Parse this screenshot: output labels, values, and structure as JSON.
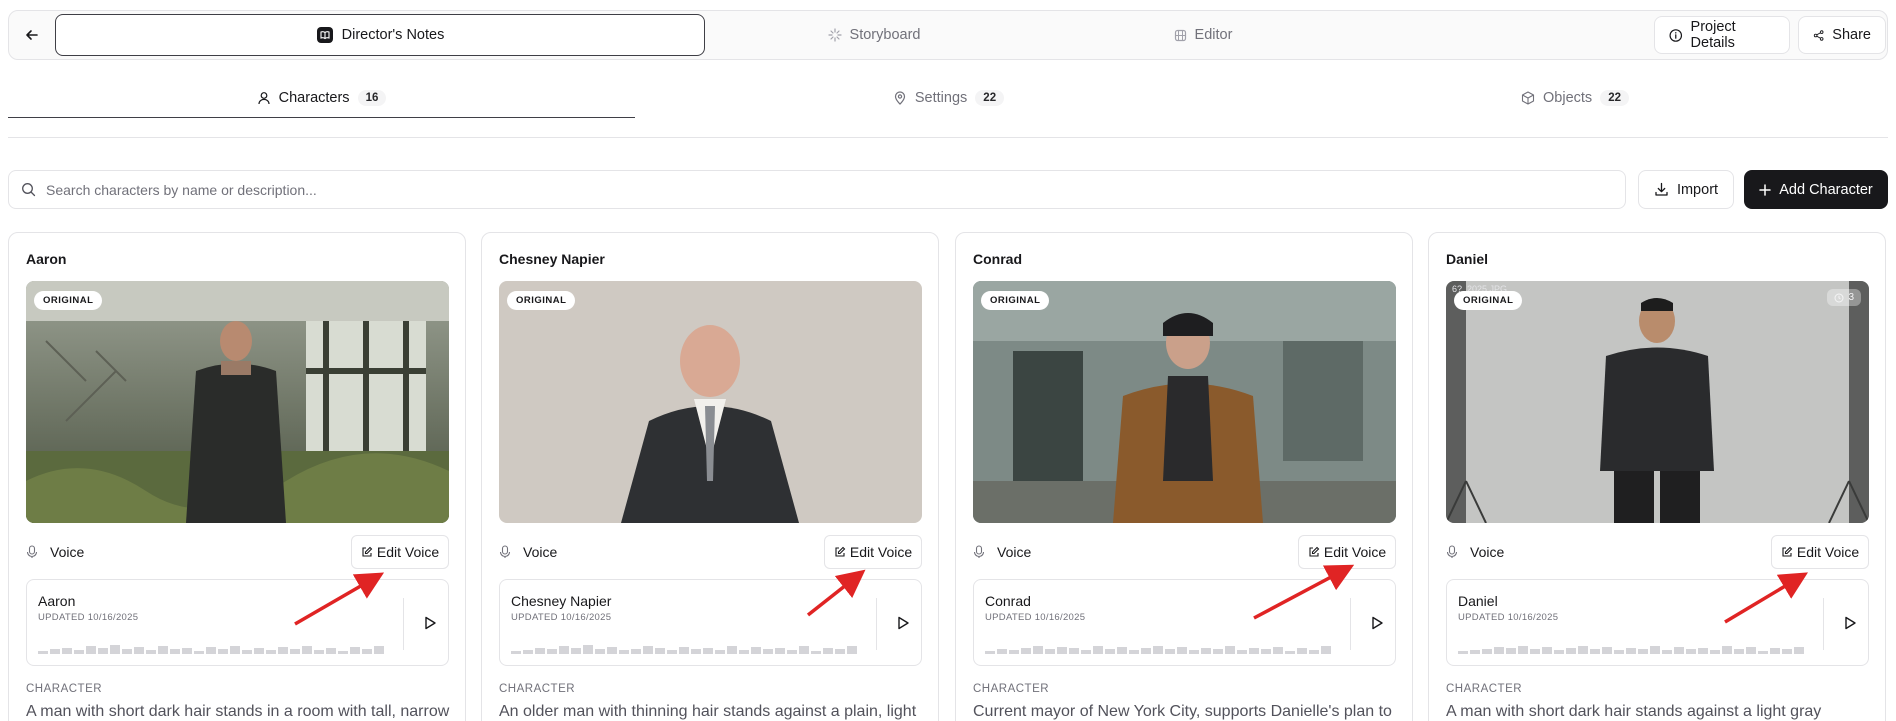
{
  "topbar": {
    "back_icon": "arrow-left-icon",
    "tabs": [
      {
        "label": "Director's Notes",
        "icon": "book-icon",
        "active": true
      },
      {
        "label": "Storyboard",
        "icon": "sparkle-icon",
        "active": false
      },
      {
        "label": "Editor",
        "icon": "film-icon",
        "active": false
      }
    ],
    "project_details_label": "Project Details",
    "share_label": "Share"
  },
  "subtabs": [
    {
      "label": "Characters",
      "count": "16",
      "icon": "user-icon",
      "active": true
    },
    {
      "label": "Settings",
      "count": "22",
      "icon": "map-pin-icon",
      "active": false
    },
    {
      "label": "Objects",
      "count": "22",
      "icon": "cube-icon",
      "active": false
    }
  ],
  "search": {
    "placeholder": "Search characters by name or description...",
    "value": ""
  },
  "import_label": "Import",
  "add_label": "Add Character",
  "cards": [
    {
      "name": "Aaron",
      "badge": "ORIGINAL",
      "voice_label": "Voice",
      "edit_voice_label": "Edit Voice",
      "player_name": "Aaron",
      "updated": "UPDATED 10/16/2025",
      "section_label": "CHARACTER",
      "description": "A man with short dark hair stands in a room with tall, narrow"
    },
    {
      "name": "Chesney Napier",
      "badge": "ORIGINAL",
      "voice_label": "Voice",
      "edit_voice_label": "Edit Voice",
      "player_name": "Chesney Napier",
      "updated": "UPDATED 10/16/2025",
      "section_label": "CHARACTER",
      "description": "An older man with thinning hair stands against a plain, light"
    },
    {
      "name": "Conrad",
      "badge": "ORIGINAL",
      "voice_label": "Voice",
      "edit_voice_label": "Edit Voice",
      "player_name": "Conrad",
      "updated": "UPDATED 10/16/2025",
      "section_label": "CHARACTER",
      "description": "Current mayor of New York City, supports Danielle's plan to"
    },
    {
      "name": "Daniel",
      "badge": "ORIGINAL",
      "file_caption": "6?_2025.JPG",
      "version_count": "3",
      "voice_label": "Voice",
      "edit_voice_label": "Edit Voice",
      "player_name": "Daniel",
      "updated": "UPDATED 10/16/2025",
      "section_label": "CHARACTER",
      "description": "A man with short dark hair stands against a light gray"
    }
  ],
  "colors": {
    "accent": "#18181b",
    "annotation_arrow": "#e02424",
    "border": "#e4e4e7",
    "muted": "#71717a"
  }
}
